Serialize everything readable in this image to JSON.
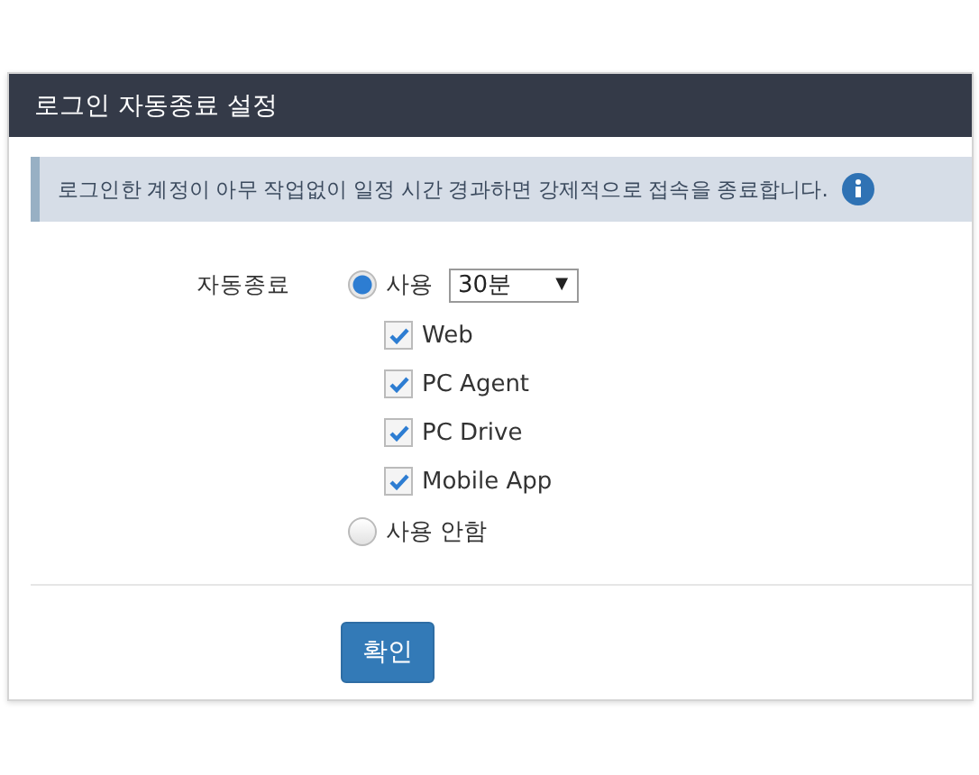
{
  "panel": {
    "title": "로그인 자동종료 설정"
  },
  "info": {
    "text": "로그인한 계정이 아무 작업없이 일정 시간 경과하면 강제적으로 접속을 종료합니다."
  },
  "form": {
    "label": "자동종료",
    "options": [
      {
        "label": "사용",
        "selected": true,
        "select": {
          "value": "30분",
          "caret": "▼"
        },
        "checks": [
          {
            "label": "Web",
            "checked": true
          },
          {
            "label": "PC Agent",
            "checked": true
          },
          {
            "label": "PC Drive",
            "checked": true
          },
          {
            "label": "Mobile App",
            "checked": true
          }
        ]
      },
      {
        "label": "사용 안함",
        "selected": false
      }
    ]
  },
  "buttons": [
    "확인"
  ]
}
